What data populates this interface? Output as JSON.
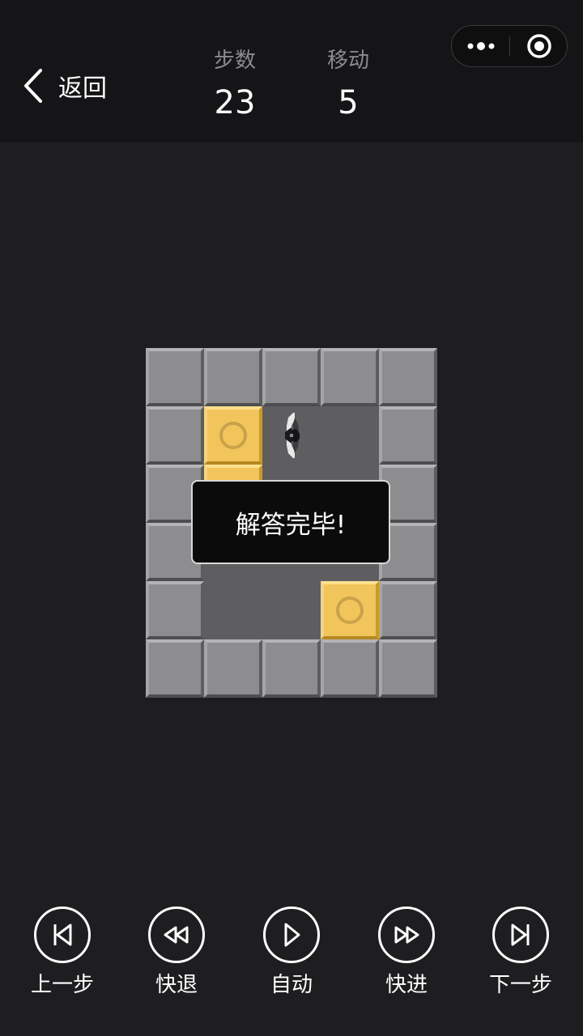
{
  "header": {
    "back_label": "返回",
    "steps_label": "步数",
    "steps_value": "23",
    "moves_label": "移动",
    "moves_value": "5"
  },
  "board": {
    "cols": 5,
    "rows": 6,
    "grid": [
      "WWWWW",
      "WB PW",
      "WB  W",
      "W   W",
      "W  BW",
      "WWWWW"
    ],
    "legend": {
      "W": "wall",
      "B": "box-on-goal",
      "P": "player",
      " ": "floor"
    }
  },
  "toast": {
    "message": "解答完毕!"
  },
  "controls": [
    {
      "key": "prev",
      "label": "上一步",
      "icon": "skip-back-icon"
    },
    {
      "key": "rewind",
      "label": "快退",
      "icon": "rewind-icon"
    },
    {
      "key": "auto",
      "label": "自动",
      "icon": "play-icon"
    },
    {
      "key": "forward",
      "label": "快进",
      "icon": "fast-forward-icon"
    },
    {
      "key": "next",
      "label": "下一步",
      "icon": "skip-forward-icon"
    }
  ],
  "colors": {
    "background": "#1e1e20",
    "header": "#151517",
    "wall": "#8d8d90",
    "floor": "#5e5e61",
    "box": "#f2c55c"
  }
}
